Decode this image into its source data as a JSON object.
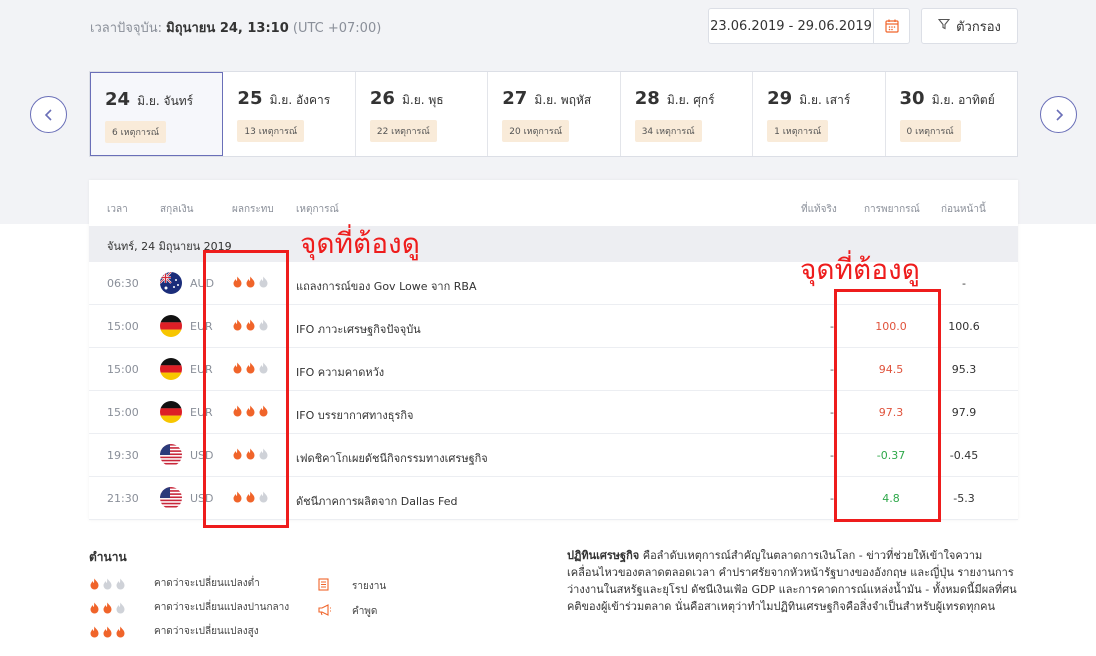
{
  "header": {
    "current_time_label": "เวลาปัจจุบัน:",
    "current_time_value": "มิถุนายน 24, 13:10",
    "timezone": "(UTC +07:00)",
    "date_range": "23.06.2019 - 29.06.2019",
    "filter_label": "ตัวกรอง"
  },
  "days": [
    {
      "num": "24",
      "label": "มิ.ย. จันทร์",
      "count": "6 เหตุการณ์",
      "active": true
    },
    {
      "num": "25",
      "label": "มิ.ย. อังคาร",
      "count": "13 เหตุการณ์"
    },
    {
      "num": "26",
      "label": "มิ.ย. พุธ",
      "count": "22 เหตุการณ์"
    },
    {
      "num": "27",
      "label": "มิ.ย. พฤหัส",
      "count": "20 เหตุการณ์"
    },
    {
      "num": "28",
      "label": "มิ.ย. ศุกร์",
      "count": "34 เหตุการณ์"
    },
    {
      "num": "29",
      "label": "มิ.ย. เสาร์",
      "count": "1 เหตุการณ์"
    },
    {
      "num": "30",
      "label": "มิ.ย. อาทิตย์",
      "count": "0 เหตุการณ์"
    }
  ],
  "table": {
    "columns": {
      "time": "เวลา",
      "currency": "สกุลเงิน",
      "impact": "ผลกระทบ",
      "event": "เหตุการณ์",
      "actual": "ที่แท้จริง",
      "forecast": "การพยากรณ์",
      "previous": "ก่อนหน้านี้"
    },
    "section": "จันทร์, 24 มิถุนายน 2019",
    "rows": [
      {
        "time": "06:30",
        "currency": "AUD",
        "flag": "au",
        "impact": 2,
        "event": "แถลงการณ์ของ Gov Lowe จาก RBA",
        "actual": "",
        "forecast": "",
        "forecast_color": "",
        "previous": "-"
      },
      {
        "time": "15:00",
        "currency": "EUR",
        "flag": "de",
        "impact": 2,
        "event": "IFO ภาวะเศรษฐกิจปัจจุบัน",
        "actual": "-",
        "forecast": "100.0",
        "forecast_color": "red",
        "previous": "100.6"
      },
      {
        "time": "15:00",
        "currency": "EUR",
        "flag": "de",
        "impact": 2,
        "event": "IFO ความคาดหวัง",
        "actual": "-",
        "forecast": "94.5",
        "forecast_color": "red",
        "previous": "95.3"
      },
      {
        "time": "15:00",
        "currency": "EUR",
        "flag": "de",
        "impact": 3,
        "event": "IFO บรรยากาศทางธุรกิจ",
        "actual": "-",
        "forecast": "97.3",
        "forecast_color": "red",
        "previous": "97.9"
      },
      {
        "time": "19:30",
        "currency": "USD",
        "flag": "us",
        "impact": 2,
        "event": "เฟดชิคาโกเผยดัชนีกิจกรรมทางเศรษฐกิจ",
        "actual": "-",
        "forecast": "-0.37",
        "forecast_color": "green",
        "previous": "-0.45"
      },
      {
        "time": "21:30",
        "currency": "USD",
        "flag": "us",
        "impact": 2,
        "event": "ดัชนีภาคการผลิตจาก Dallas Fed",
        "actual": "-",
        "forecast": "4.8",
        "forecast_color": "green",
        "previous": "-5.3"
      }
    ]
  },
  "annotations": {
    "text_left": "จุดที่ต้องดู",
    "text_right": "จุดที่ต้องดู",
    "color": "#ee1c1c"
  },
  "legend": {
    "title": "ตำนาน",
    "low": "คาดว่าจะเปลี่ยนแปลงต่ำ",
    "medium": "คาดว่าจะเปลี่ยนแปลงปานกลาง",
    "high": "คาดว่าจะเปลี่ยนแปลงสูง",
    "report": "รายงาน",
    "speech": "คำพูด"
  },
  "info": {
    "title": "ปฏิทินเศรษฐกิจ",
    "body": "คือลำดับเหตุการณ์สำคัญในตลาดการเงินโลก - ข่าวที่ช่วยให้เข้าใจความเคลื่อนไหวของตลาดตลอดเวลา คำปราศรัยจากหัวหน้ารัฐบางของอังกฤษ และญี่ปุ่น รายงานการว่างงานในสหรัฐและยุโรป ดัชนีเงินเฟ้อ GDP และการคาดการณ์แหล่งน้ำมัน - ทั้งหมดนี้มีผลที่ศนคติของผู้เข้าร่วมตลาด นั่นคือสาเหตุว่าทำไมปฏิทินเศรษฐกิจคือสิ่งจำเป็นสำหรับผู้เทรดทุกคน"
  },
  "colors": {
    "accent": "#6a6fb8",
    "flame_on": "#f0642a",
    "flame_off": "#cfd2d8",
    "forecast_red": "#e0533c",
    "forecast_green": "#2ea84a"
  }
}
